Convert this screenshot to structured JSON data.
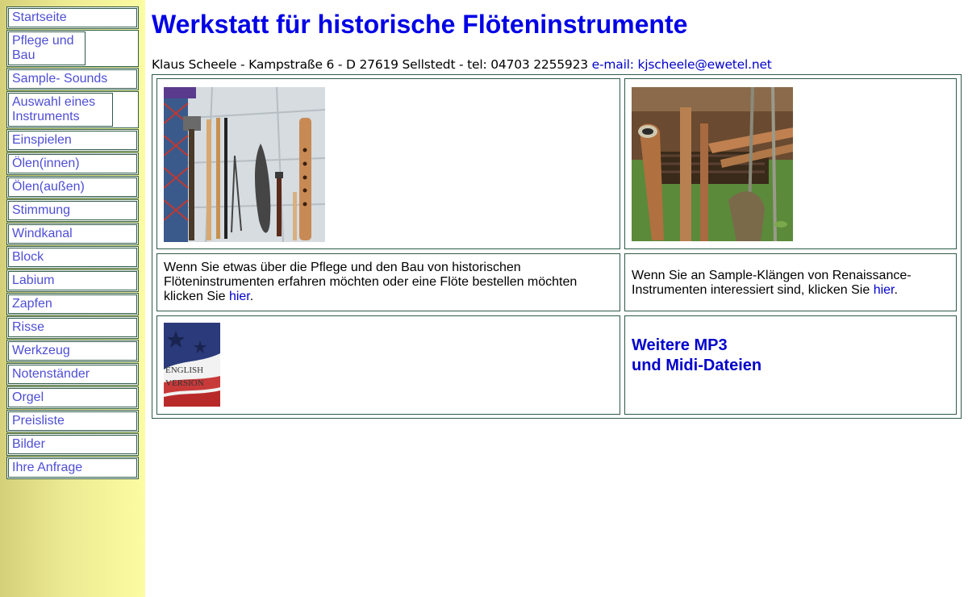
{
  "nav": {
    "items": [
      {
        "label": "Startseite"
      },
      {
        "label": "Pflege und Bau"
      },
      {
        "label": "Sample- Sounds"
      },
      {
        "label": "Auswahl eines Instruments"
      },
      {
        "label": "Einspielen"
      },
      {
        "label": "Ölen(innen)"
      },
      {
        "label": "Ölen(außen)"
      },
      {
        "label": "Stimmung"
      },
      {
        "label": "Windkanal"
      },
      {
        "label": "Block"
      },
      {
        "label": "Labium"
      },
      {
        "label": "Zapfen"
      },
      {
        "label": "Risse"
      },
      {
        "label": "Werkzeug"
      },
      {
        "label": "Notenständer"
      },
      {
        "label": "Orgel"
      },
      {
        "label": "Preisliste"
      },
      {
        "label": "Bilder"
      },
      {
        "label": "Ihre Anfrage"
      }
    ]
  },
  "header": {
    "title": "Werkstatt für historische Flöteninstrumente",
    "contact": "Klaus Scheele - Kampstraße 6 - D 27619 Sellstedt - tel: 04703 2255923",
    "email_label": "e-mail: kjscheele@ewetel.net"
  },
  "cells": {
    "care": {
      "text_before": "Wenn Sie etwas über die Pflege und den Bau von historischen Flöteninstrumenten erfahren möchten oder eine Flöte bestellen möchten klicken Sie",
      "link": "hier",
      "text_after": "."
    },
    "samples": {
      "text_before": "Wenn Sie an Sample-Klängen von Renaissance-Instrumenten interessiert sind, klicken Sie",
      "link": "hier",
      "text_after": "."
    },
    "english": {
      "image_line1": "ENGLISH",
      "image_line2": "VERSION"
    },
    "more": {
      "line1": "Weitere MP3",
      "line2": "und Midi-Dateien"
    }
  },
  "colors": {
    "title": "#0000e6",
    "link": "#0000cc",
    "nav_link": "#4e4ed6",
    "border": "#2e5a48",
    "sidebar_gradient_start": "#d4d07a",
    "sidebar_gradient_end": "#fcfca2"
  },
  "icons": {
    "tools_photo": "flute-tools-photo",
    "instruments_photo": "renaissance-instruments-photo",
    "flag_photo": "english-version-flag"
  }
}
